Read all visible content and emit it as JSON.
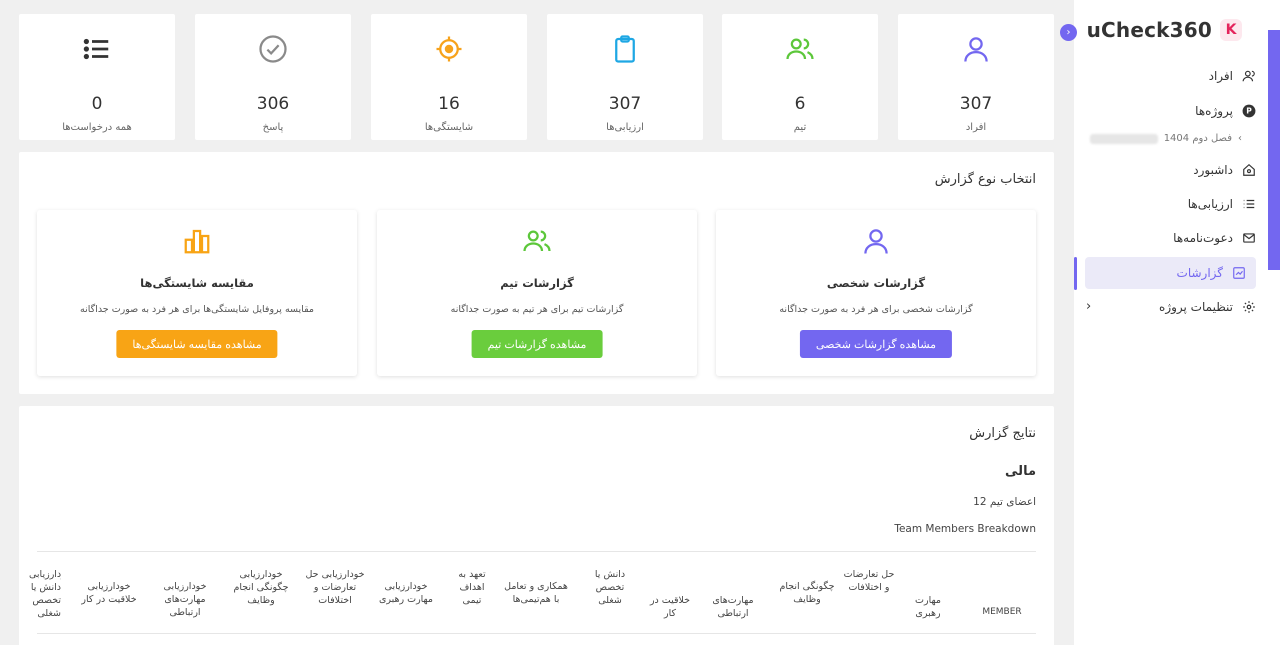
{
  "brand": {
    "name": "uCheck360",
    "mark": "K"
  },
  "sidebar": {
    "items": [
      {
        "label": "افراد",
        "icon": "users-icon"
      },
      {
        "label": "پروژه‌ها",
        "icon": "project-p-icon"
      },
      {
        "label": "داشبورد",
        "icon": "home-icon"
      },
      {
        "label": "ارزیابی‌ها",
        "icon": "list-icon"
      },
      {
        "label": "دعوت‌نامه‌ها",
        "icon": "mail-icon"
      },
      {
        "label": "گزارشات",
        "icon": "chart-icon",
        "active": true
      },
      {
        "label": "تنظیمات پروژه",
        "icon": "gear-icon"
      }
    ],
    "sub_item": "فصل دوم 1404"
  },
  "stats": [
    {
      "value": "307",
      "label": "افراد",
      "icon": "user-icon",
      "color": "#7367f0"
    },
    {
      "value": "6",
      "label": "تیم",
      "icon": "team-icon",
      "color": "#5cc73a"
    },
    {
      "value": "307",
      "label": "ارزیابی‌ها",
      "icon": "clipboard-icon",
      "color": "#1ea7e4"
    },
    {
      "value": "16",
      "label": "شایستگی‌ها",
      "icon": "target-icon",
      "color": "#f7a21b"
    },
    {
      "value": "306",
      "label": "پاسخ",
      "icon": "check-circle-icon",
      "color": "#8a8a8a"
    },
    {
      "value": "0",
      "label": "همه درخواست‌ها",
      "icon": "list-icon",
      "color": "#333333"
    }
  ],
  "report_select": {
    "title": "انتخاب نوع گزارش",
    "cards": [
      {
        "title": "گزارشات شخصی",
        "desc": "گزارشات شخصی برای هر فرد به صورت جداگانه",
        "button": "مشاهده گزارشات شخصی",
        "color": "#7367f0",
        "icon": "user-icon"
      },
      {
        "title": "گزارشات تیم",
        "desc": "گزارشات تیم برای هر تیم به صورت جداگانه",
        "button": "مشاهده گزارشات تیم",
        "color": "#6acd3d",
        "icon": "team-icon"
      },
      {
        "title": "مقایسه شایستگی‌ها",
        "desc": "مقایسه پروفایل شایستگی‌ها برای هر فرد به صورت جداگانه",
        "button": "مشاهده مقایسه شایستگی‌ها",
        "color": "#f8a415",
        "icon": "bar-chart-icon"
      }
    ]
  },
  "results": {
    "title": "نتایج گزارش",
    "team_name": "مالی",
    "members_count": "12 اعضای تیم",
    "breakdown_label": "Team Members Breakdown",
    "columns": [
      "MEMBER",
      "مهارت رهبری",
      "حل تعارضات و اختلافات",
      "چگونگی انجام وظایف",
      "مهارت‌های ارتباطی",
      "خلاقیت در کار",
      "دانش یا تخصص شغلی",
      "همکاری و تعامل با هم‌تیمی‌ها",
      "تعهد به اهداف تیمی",
      "خودارزیابی مهارت رهبری",
      "خودارزیابی حل تعارضات و اختلافات",
      "خودارزیابی چگونگی انجام وظایف",
      "خودارزیابی مهارت‌های ارتباطی",
      "خودارزیابی خلاقیت در کار",
      "خودارزیابی دانش یا تخصص شغلی"
    ]
  }
}
